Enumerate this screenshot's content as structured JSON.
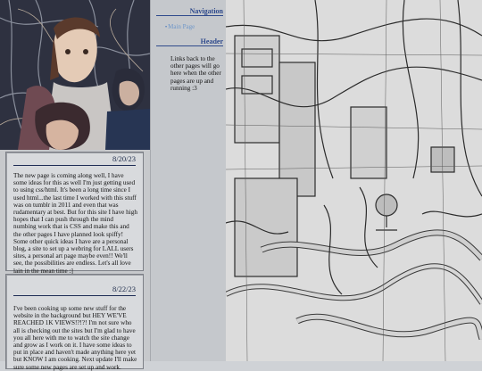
{
  "sidebar": {
    "navigation_heading": "Navigation",
    "nav_items": [
      {
        "label": "Main Page"
      }
    ],
    "header_heading": "Header",
    "header_text": "Links back to the other pages will go here when the other pages are up and running :3"
  },
  "posts": [
    {
      "date": "8/20/23",
      "body": "The new page is coming along well, I have some ideas for this as well I'm just getting used to using css/html. It's been a long time since I used html...the last time I worked with this stuff was on tumblr in 2011 and even that was rudamentary at best. But for this site I have high hopes that I can push through the mind numbing work that is CSS and make this and the other pages I have planned look spiffy! Some other quick ideas I have are a personal blog, a site to set up a webring for LALL users sites, a personal art page maybe even!! We'll see, the possibilities are endless. Let's all love lain in the mean time :]"
    },
    {
      "date": "8/22/23",
      "body": "I've been cooking up some new stuff for the website in the background but HEY WE'VE REACHED 1K VIEWS!?!?! I'm not sure who all is checking out the sites but I'm glad to have you all here with me to watch the site change and grow as I work on it. I have some ideas to put in place and haven't made anything here yet but KNOW I am cooking. Next update I'll make sure some new pages are set up and work."
    }
  ],
  "colors": {
    "heading": "#2f4a8c",
    "link": "#6e97c9",
    "panel": "#d8dadd"
  }
}
